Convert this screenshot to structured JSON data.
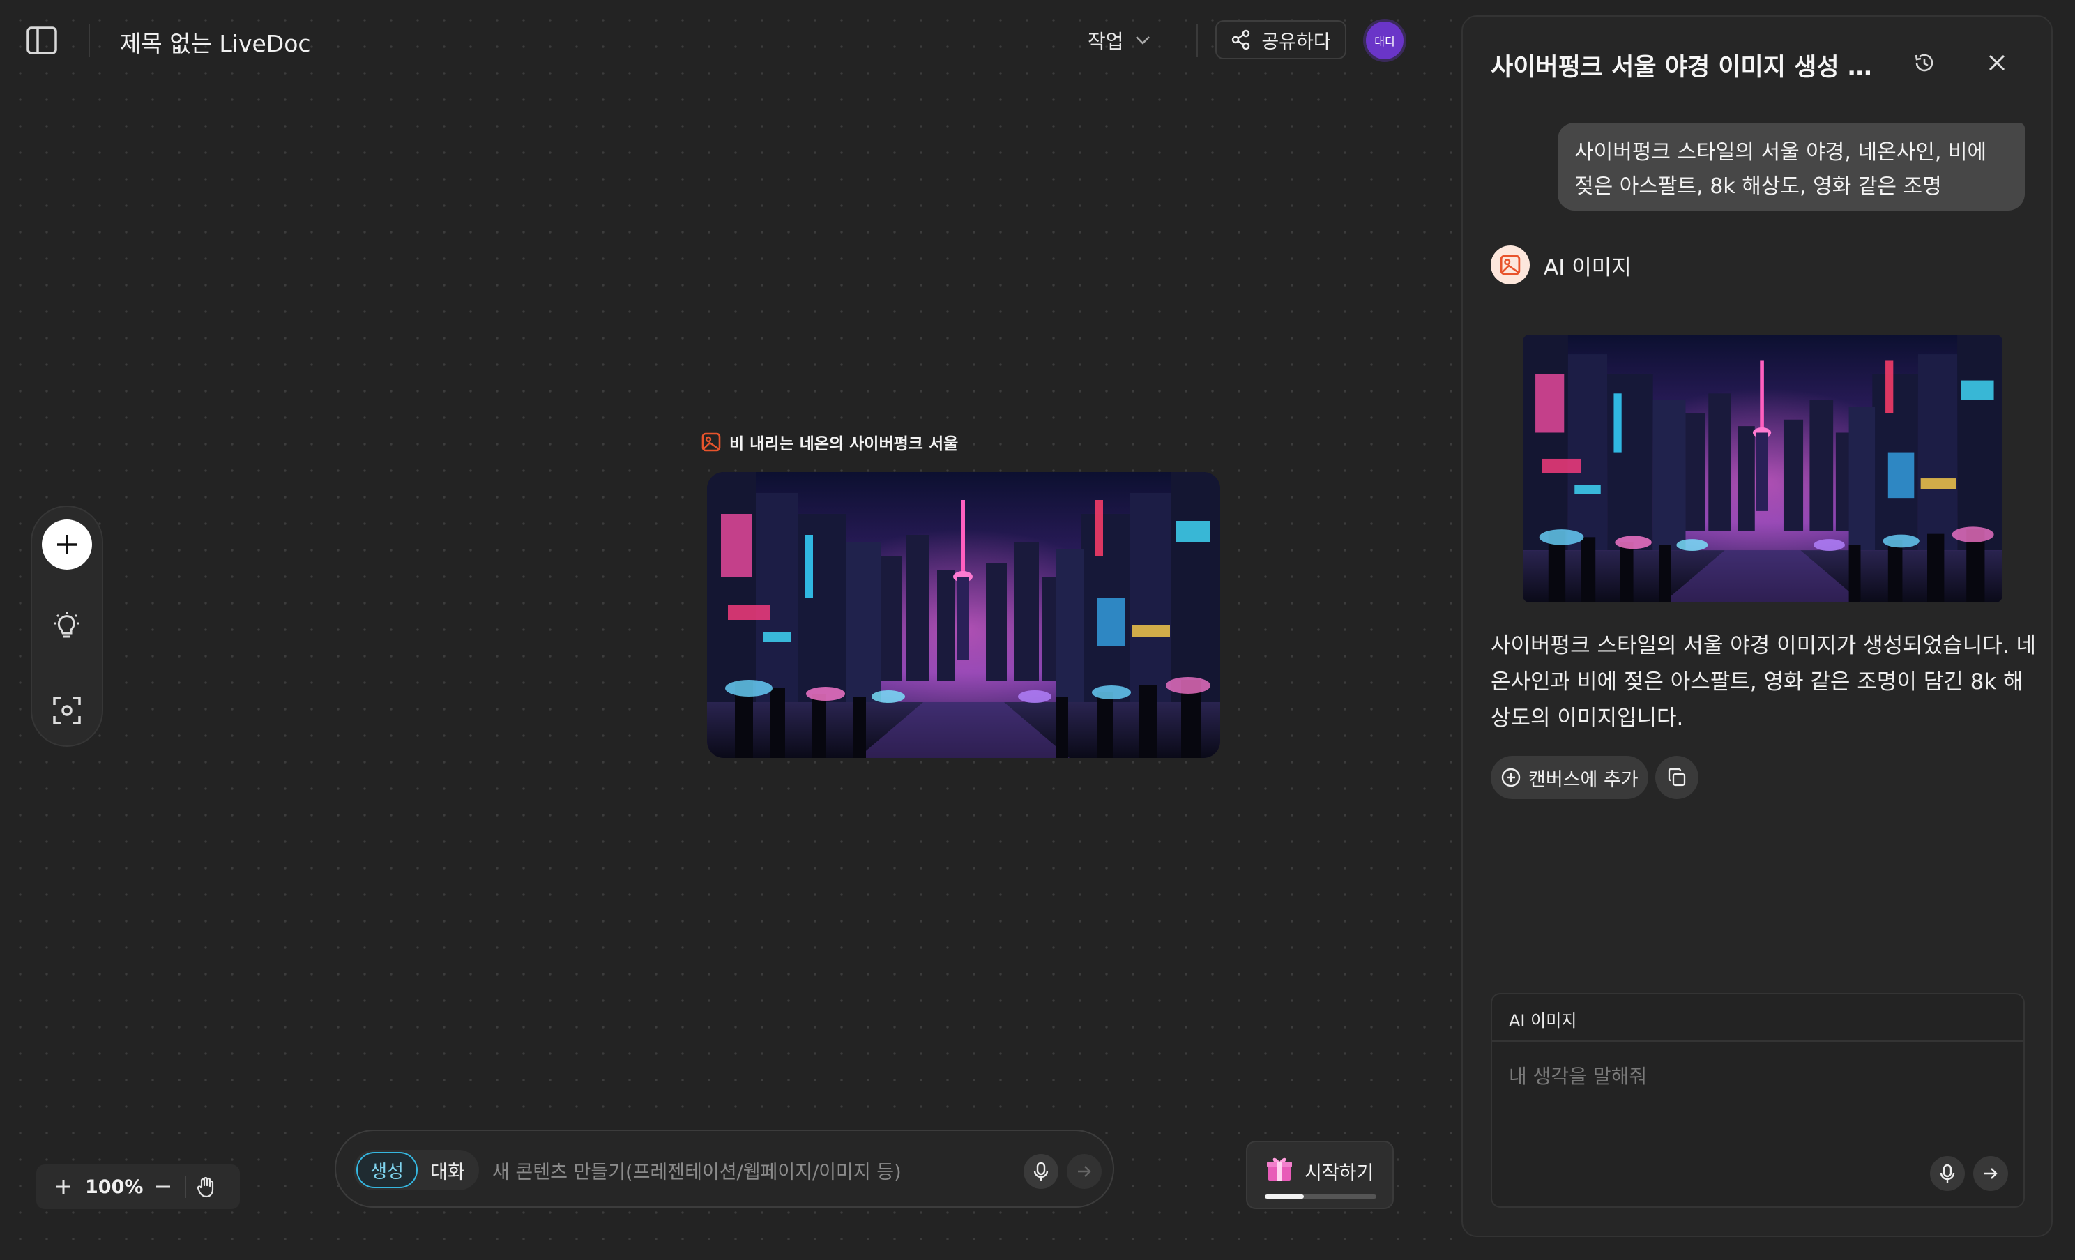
{
  "colors": {
    "background": "#232323",
    "panel": "#262626",
    "accent_generate": "#35b7e0",
    "avatar": "#6a35c8",
    "image_icon": "#e8542c"
  },
  "topbar": {
    "sidebar_toggle_icon": "sidebar-icon",
    "doc_title": "제목 없는 LiveDoc",
    "work_menu_label": "작업",
    "share_label": "공유하다",
    "avatar_text": "대디"
  },
  "left_tools": {
    "items": [
      {
        "name": "add",
        "icon": "plus-icon"
      },
      {
        "name": "ideas",
        "icon": "lightbulb-icon"
      },
      {
        "name": "capture",
        "icon": "focus-capture-icon"
      }
    ]
  },
  "canvas_card": {
    "label": "비 내리는 네온의 사이버펑크 서울",
    "image_alt": "cyberpunk seoul night image"
  },
  "zoom": {
    "value": "100%"
  },
  "prompt": {
    "mode_generate": "생성",
    "mode_chat": "대화",
    "placeholder": "새 콘텐츠 만들기(프레젠테이션/웹페이지/이미지 등)"
  },
  "start": {
    "label": "시작하기",
    "progress": 0.35
  },
  "panel": {
    "title": "사이버펑크 서울 야경 이미지 생성 …",
    "user_message": "사이버펑크 스타일의 서울 야경, 네온사인, 비에 젖은 아스팔트, 8k 해상도, 영화 같은 조명",
    "ai_badge_label": "AI 이미지",
    "ai_response": "사이버펑크 스타일의 서울 야경 이미지가 생성되었습니다. 네온사인과 비에 젖은 아스팔트, 영화 같은 조명이 담긴 8k 해상도의 이미지입니다.",
    "add_to_canvas_label": "캔버스에 추가",
    "input_header": "AI 이미지",
    "input_placeholder": "내 생각을 말해줘"
  }
}
